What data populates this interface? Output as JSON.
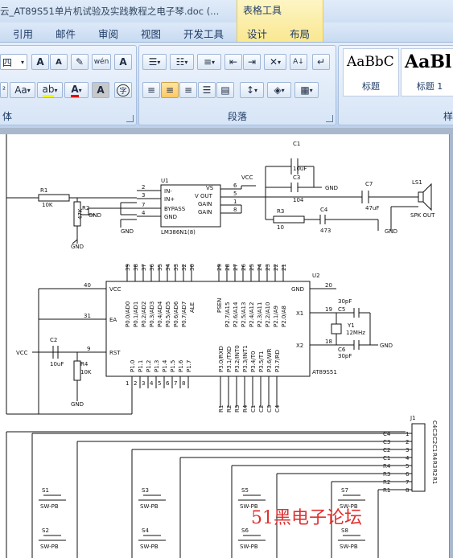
{
  "window": {
    "title": "云_AT89S51单片机试验及实践教程之电子琴.doc (...",
    "context_tab_group": "表格工具"
  },
  "menu": {
    "tabs": [
      "引用",
      "邮件",
      "审阅",
      "视图",
      "开发工具",
      "设计",
      "布局"
    ]
  },
  "ribbon": {
    "font_group": {
      "label": "体",
      "font_size": "四",
      "grow_label": "A",
      "shrink_label": "A",
      "clear_label": "Aᵃ",
      "phonetic_label": "wén",
      "border_char_label": "A",
      "superscript_label": "x²",
      "change_case_label": "Aa",
      "highlight_label": "ab",
      "font_color_label": "A",
      "shading_label": "A",
      "enclose_label": "字",
      "highlight_color": "#f5f500",
      "font_color": "#e00000"
    },
    "paragraph_group": {
      "label": "段落"
    },
    "styles_group": {
      "label": "样",
      "styles": [
        {
          "sample": "AaBbC",
          "name": "标题"
        },
        {
          "sample": "AaBl",
          "name": "标题 1"
        }
      ]
    }
  },
  "schematic": {
    "components": {
      "r1": {
        "ref": "R1",
        "value": "10K"
      },
      "r2": {
        "ref": "R2",
        "value": "47K"
      },
      "r3": {
        "ref": "R3",
        "value": "10"
      },
      "r4": {
        "ref": "R4",
        "value": "10K"
      },
      "u1": {
        "ref": "U1",
        "part": "LM386N1(8)"
      },
      "u2": {
        "ref": "U2",
        "part": "AT89S51"
      },
      "c1": {
        "ref": "C1",
        "value": "10uF"
      },
      "c2": {
        "ref": "C2",
        "value": "10uF"
      },
      "c3": {
        "ref": "C3",
        "value": "104"
      },
      "c4": {
        "ref": "C4",
        "value": "473"
      },
      "c5": {
        "ref": "C5",
        "value": "30pF"
      },
      "c6": {
        "ref": "C6",
        "value": "30pF"
      },
      "c7": {
        "ref": "C7",
        "value": "47uF"
      },
      "y1": {
        "ref": "Y1",
        "value": "12MHz"
      },
      "ls1": {
        "ref": "LS1",
        "label": "SPK OUT"
      },
      "j1": {
        "ref": "J1"
      }
    },
    "net_labels": {
      "vcc": "VCC",
      "gnd": "GND"
    },
    "u1_pins": {
      "left": [
        "IN-",
        "IN+",
        "BYPASS",
        "GND"
      ],
      "left_nums": [
        "2",
        "3",
        "7",
        "4"
      ],
      "right": [
        "VS",
        "V OUT",
        "GAIN",
        "GAIN"
      ],
      "right_nums": [
        "6",
        "5",
        "1",
        "8"
      ]
    },
    "u2_pins": {
      "vcc": "VCC",
      "ea": "EA",
      "rst": "RST",
      "gnd": "GND",
      "x1": "X1",
      "x2": "X2",
      "vcc_num": "40",
      "ea_num": "31",
      "rst_num": "9",
      "gnd_num": "20",
      "x1_num": "19",
      "x2_num": "18",
      "p0": [
        "P0.0/AD0",
        "P0.1/AD1",
        "P0.2/AD2",
        "P0.3/AD3",
        "P0.4/AD4",
        "P0.5/AD5",
        "P0.6/AD6",
        "P0.7/AD7"
      ],
      "p2": [
        "P2.7/A15",
        "P2.6/A14",
        "P2.5/A13",
        "P2.4/A12",
        "P2.3/A11",
        "P2.2/A10",
        "P2.1/A9",
        "P2.0/A8"
      ],
      "p1": [
        "P1.0",
        "P1.1",
        "P1.2",
        "P1.3",
        "P1.4",
        "P1.5",
        "P1.6",
        "P1.7"
      ],
      "p1_nums": [
        "1",
        "2",
        "3",
        "4",
        "5",
        "6",
        "7",
        "8"
      ],
      "p3": [
        "P3.0/RXD",
        "P3.1/TXD",
        "P3.2/INT0",
        "P3.3/INT1",
        "P3.4/T0",
        "P3.5/T1",
        "P3.6/WR",
        "P3.7/RD"
      ],
      "top_nums": [
        "39",
        "38",
        "37",
        "36",
        "35",
        "34",
        "33",
        "32",
        "30",
        "29",
        "28",
        "27",
        "26",
        "25",
        "24",
        "23",
        "22",
        "21"
      ],
      "ale": "ALE",
      "psen": "PSEN",
      "bottom_nets": [
        "R1",
        "R2",
        "R3",
        "R4",
        "C1",
        "C2",
        "C3",
        "C4"
      ]
    },
    "j1_nets": [
      "C4",
      "C3",
      "C2",
      "C1",
      "R4",
      "R3",
      "R2",
      "R1"
    ],
    "j1_nums": [
      "1",
      "2",
      "3",
      "4",
      "5",
      "6",
      "7",
      "8"
    ],
    "switches": [
      {
        "ref": "S1",
        "label": "SW-PB"
      },
      {
        "ref": "S2",
        "label": "SW-PB"
      },
      {
        "ref": "S3",
        "label": "SW-PB"
      },
      {
        "ref": "S4",
        "label": "SW-PB"
      },
      {
        "ref": "S5",
        "label": "SW-PB"
      },
      {
        "ref": "S6",
        "label": "SW-PB"
      },
      {
        "ref": "S7",
        "label": "SW-PB"
      },
      {
        "ref": "S8",
        "label": "SW-PB"
      }
    ]
  },
  "watermark": "51黑电子论坛"
}
